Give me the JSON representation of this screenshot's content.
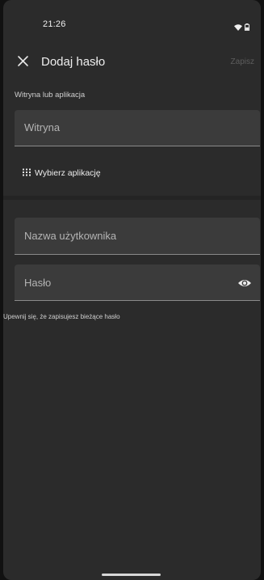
{
  "status_bar": {
    "time": "21:26",
    "icons": [
      "wifi-icon",
      "battery-icon"
    ]
  },
  "app_bar": {
    "title": "Dodaj hasło",
    "save_label": "Zapisz",
    "close_icon": "close-icon"
  },
  "site_section": {
    "label": "Witryna lub aplikacja",
    "site_placeholder": "Witryna",
    "pick_app_label": "Wybierz aplikację",
    "pick_app_icon": "apps-grid-icon"
  },
  "credentials": {
    "username_placeholder": "Nazwa użytkownika",
    "password_placeholder": "Hasło",
    "password_toggle_icon": "eye-icon",
    "hint": "Upewnij się, że zapisujesz bieżące hasło"
  },
  "colors": {
    "background": "#2b2b2b",
    "field": "#3b3b3b",
    "save_disabled": "#5d5d5d"
  }
}
